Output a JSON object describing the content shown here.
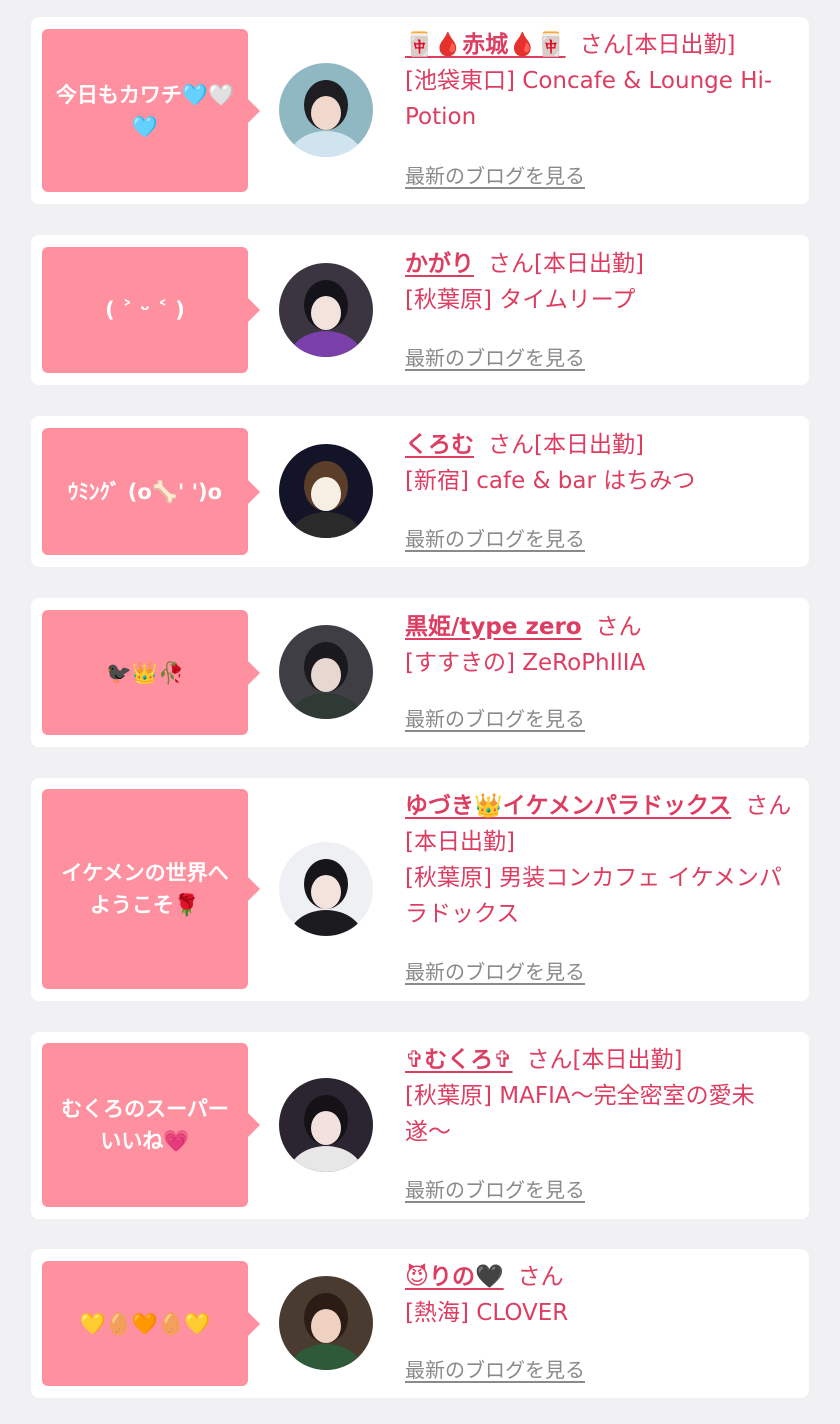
{
  "common": {
    "san": "さん",
    "blog_link": "最新のブログを見る"
  },
  "cards": [
    {
      "bubble": "今日もカワチ🩵🤍🩵",
      "name": "🀄🩸赤城🩸🀄",
      "status": "[本日出勤]",
      "area": "[池袋東口]",
      "shop": "Concafe & Lounge Hi-Potion"
    },
    {
      "bubble": "( ˃ ᵕ ˂ )",
      "name": "かがり",
      "status": "[本日出勤]",
      "area": "[秋葉原]",
      "shop": "タイムリープ"
    },
    {
      "bubble": "ｳﾐﾝｸﾞ (o🦴' ')o",
      "name": "くろむ",
      "status": "[本日出勤]",
      "area": "[新宿]",
      "shop": "cafe & bar はちみつ"
    },
    {
      "bubble": "🐦‍⬛👑🥀",
      "name": "黒姫/type zero",
      "status": "",
      "area": "[すすきの]",
      "shop": "ZeRoPhIlIA"
    },
    {
      "bubble": "イケメンの世界へようこそ🌹",
      "name": "ゆづき👑イケメンパラドックス",
      "status": "[本日出勤]",
      "area": "[秋葉原]",
      "shop": "男装コンカフェ イケメンパラドックス"
    },
    {
      "bubble": "むくろのスーパーいいね💗",
      "name": "✞むくろ✞",
      "status": "[本日出勤]",
      "area": "[秋葉原]",
      "shop": "MAFIA〜完全密室の愛未遂〜"
    },
    {
      "bubble": "💛🥚🧡🥚💛",
      "name": "😈りの🖤",
      "status": "",
      "area": "[熱海]",
      "shop": "CLOVER"
    }
  ],
  "avatars": [
    {
      "bg": "#8fb8c2",
      "hair": "#1d1d22",
      "skin": "#f1d8cc",
      "cloth": "#cfe4ee"
    },
    {
      "bg": "#3a3540",
      "hair": "#15131a",
      "skin": "#f4e2dc",
      "cloth": "#7a3fa8"
    },
    {
      "bg": "#141428",
      "hair": "#5a3e2a",
      "skin": "#f6efe4",
      "cloth": "#2a2a2a"
    },
    {
      "bg": "#3e3e44",
      "hair": "#1a1a1e",
      "skin": "#e8d6d0",
      "cloth": "#2f3a34"
    },
    {
      "bg": "#eef0f4",
      "hair": "#15151a",
      "skin": "#f3e3dc",
      "cloth": "#1c1c20"
    },
    {
      "bg": "#2a2530",
      "hair": "#141216",
      "skin": "#f2e1dc",
      "cloth": "#e7e7e7"
    },
    {
      "bg": "#4a3b30",
      "hair": "#2b1d16",
      "skin": "#eed1bf",
      "cloth": "#2f5a3a"
    }
  ]
}
